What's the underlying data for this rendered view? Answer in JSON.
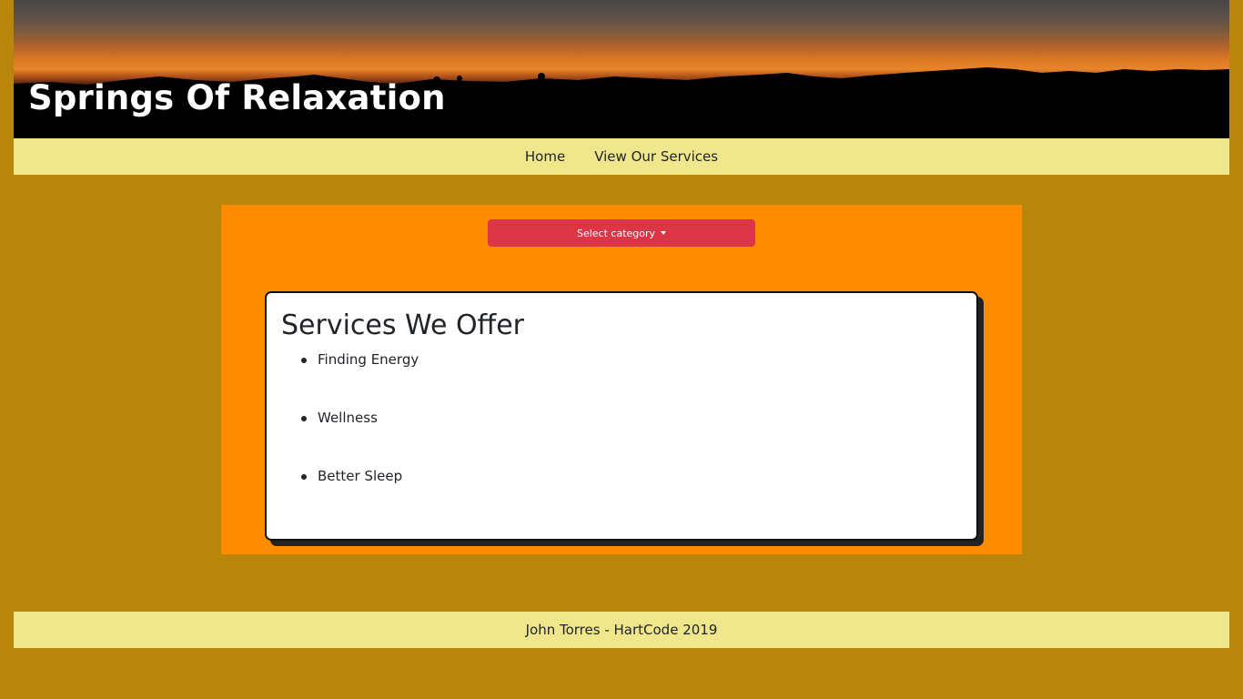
{
  "header": {
    "title": "Springs Of Relaxation",
    "banner_image": "sunset-mountains-image"
  },
  "nav": {
    "items": [
      {
        "label": "Home"
      },
      {
        "label": "View Our Services"
      }
    ]
  },
  "main": {
    "dropdown": {
      "label": "Select category",
      "icon": "caret-down-icon",
      "color": "#dc3545"
    },
    "card": {
      "title": "Services We Offer",
      "services": [
        {
          "label": "Finding Energy"
        },
        {
          "label": "Wellness"
        },
        {
          "label": "Better Sleep"
        }
      ]
    }
  },
  "footer": {
    "text": "John Torres - HartCode 2019"
  },
  "colors": {
    "page_background": "#b8860b",
    "nav_background": "#f0e68c",
    "panel_background": "#ff8c00",
    "card_background": "#ffffff"
  }
}
